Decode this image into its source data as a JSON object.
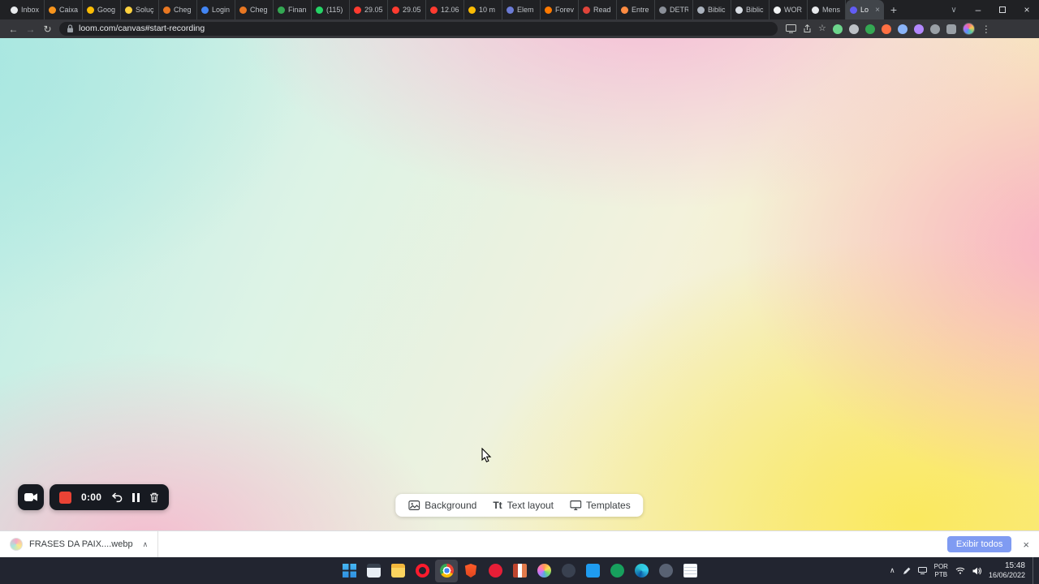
{
  "browser": {
    "tabs": [
      {
        "label": "Inbox",
        "color": "#e8eaed"
      },
      {
        "label": "Caixa",
        "color": "#f7941d"
      },
      {
        "label": "Goog",
        "color": "#fbbc04"
      },
      {
        "label": "Soluç",
        "color": "#ffd23f"
      },
      {
        "label": "Cheg",
        "color": "#e87722"
      },
      {
        "label": "Login",
        "color": "#4285f4"
      },
      {
        "label": "Cheg",
        "color": "#e87722"
      },
      {
        "label": "Finan",
        "color": "#34a853"
      },
      {
        "label": "(115)",
        "color": "#25d366"
      },
      {
        "label": "29.05",
        "color": "#ff3b30"
      },
      {
        "label": "29.05",
        "color": "#ff3b30"
      },
      {
        "label": "12.06",
        "color": "#ff3b30"
      },
      {
        "label": "10 m",
        "color": "#fbbc04"
      },
      {
        "label": "Elem",
        "color": "#6b7bd6"
      },
      {
        "label": "Forev",
        "color": "#ff7a00"
      },
      {
        "label": "Read",
        "color": "#e0443a"
      },
      {
        "label": "Entre",
        "color": "#ff8c42"
      },
      {
        "label": "DETR",
        "color": "#8a8f98"
      },
      {
        "label": "Biblic",
        "color": "#aab2bd"
      },
      {
        "label": "Biblic",
        "color": "#d8dde3"
      },
      {
        "label": "WOR",
        "color": "#f1f3f4"
      },
      {
        "label": "Mens",
        "color": "#e8eaed"
      },
      {
        "label": "Lo",
        "color": "#625df5"
      }
    ],
    "active_tab": 22,
    "address": {
      "url": "loom.com/canvas#start-recording"
    },
    "extensions": [
      {
        "name": "extension-green",
        "color": "#6dd58c"
      },
      {
        "name": "extension-gray",
        "color": "#bdc1c6"
      },
      {
        "name": "extension-adblock",
        "color": "#34a853"
      },
      {
        "name": "extension-orange",
        "color": "#ff7043"
      },
      {
        "name": "extension-blue",
        "color": "#8ab4f8"
      },
      {
        "name": "extension-purple",
        "color": "#b388ff"
      },
      {
        "name": "extension-silver",
        "color": "#9aa0a6"
      }
    ]
  },
  "icons": {
    "new_tab": "+",
    "tab_search": "∨",
    "minimize": "–",
    "close_window": "×",
    "back": "←",
    "forward": "→",
    "reload": "↻",
    "bookmark": "☆",
    "menu": "⋮",
    "downloads_caret": "∧",
    "tray_caret": "∧",
    "download_close": "×",
    "text_layout_glyph": "Tt"
  },
  "recorder": {
    "timer": "0:00"
  },
  "canvas_toolbar": {
    "items": [
      {
        "label": "Background"
      },
      {
        "label": "Text layout"
      },
      {
        "label": "Templates"
      }
    ]
  },
  "download_bar": {
    "filename": "FRASES DA PAIX....webp",
    "show_all_label": "Exibir todos"
  },
  "taskbar": {
    "apps": [
      {
        "name": "start"
      },
      {
        "name": "calculator"
      },
      {
        "name": "files"
      },
      {
        "name": "opera"
      },
      {
        "name": "chrome",
        "active": true
      },
      {
        "name": "brave"
      },
      {
        "name": "operagx"
      },
      {
        "name": "books"
      },
      {
        "name": "photos"
      },
      {
        "name": "game"
      },
      {
        "name": "vscode"
      },
      {
        "name": "green"
      },
      {
        "name": "edge"
      },
      {
        "name": "gray"
      },
      {
        "name": "notepad"
      }
    ],
    "tray": {
      "lang_top": "POR",
      "lang_bottom": "PTB",
      "time": "15:48",
      "date": "16/06/2022"
    }
  }
}
